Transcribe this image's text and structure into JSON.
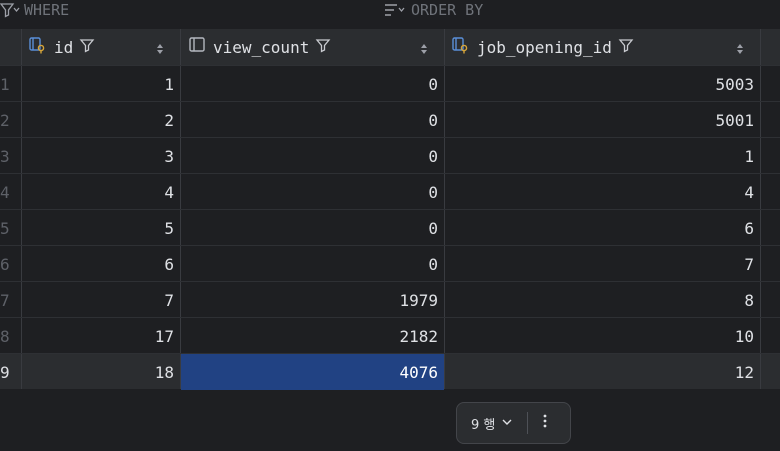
{
  "filter_bar": {
    "where_label": "WHERE",
    "order_by_label": "ORDER BY"
  },
  "columns": [
    {
      "name": "id",
      "icon": "key-column-icon"
    },
    {
      "name": "view_count",
      "icon": "column-icon"
    },
    {
      "name": "job_opening_id",
      "icon": "key-column-icon"
    }
  ],
  "rows": [
    {
      "n": "1",
      "id": "1",
      "view_count": "0",
      "job_opening_id": "5003"
    },
    {
      "n": "2",
      "id": "2",
      "view_count": "0",
      "job_opening_id": "5001"
    },
    {
      "n": "3",
      "id": "3",
      "view_count": "0",
      "job_opening_id": "1"
    },
    {
      "n": "4",
      "id": "4",
      "view_count": "0",
      "job_opening_id": "4"
    },
    {
      "n": "5",
      "id": "5",
      "view_count": "0",
      "job_opening_id": "6"
    },
    {
      "n": "6",
      "id": "6",
      "view_count": "0",
      "job_opening_id": "7"
    },
    {
      "n": "7",
      "id": "7",
      "view_count": "1979",
      "job_opening_id": "8"
    },
    {
      "n": "8",
      "id": "17",
      "view_count": "2182",
      "job_opening_id": "10"
    },
    {
      "n": "9",
      "id": "18",
      "view_count": "4076",
      "job_opening_id": "12"
    }
  ],
  "pager": {
    "row_count_label": "9 행"
  },
  "colors": {
    "background": "#1e1f22",
    "header": "#2b2d30",
    "selection": "#214283",
    "muted": "#6f737a"
  }
}
